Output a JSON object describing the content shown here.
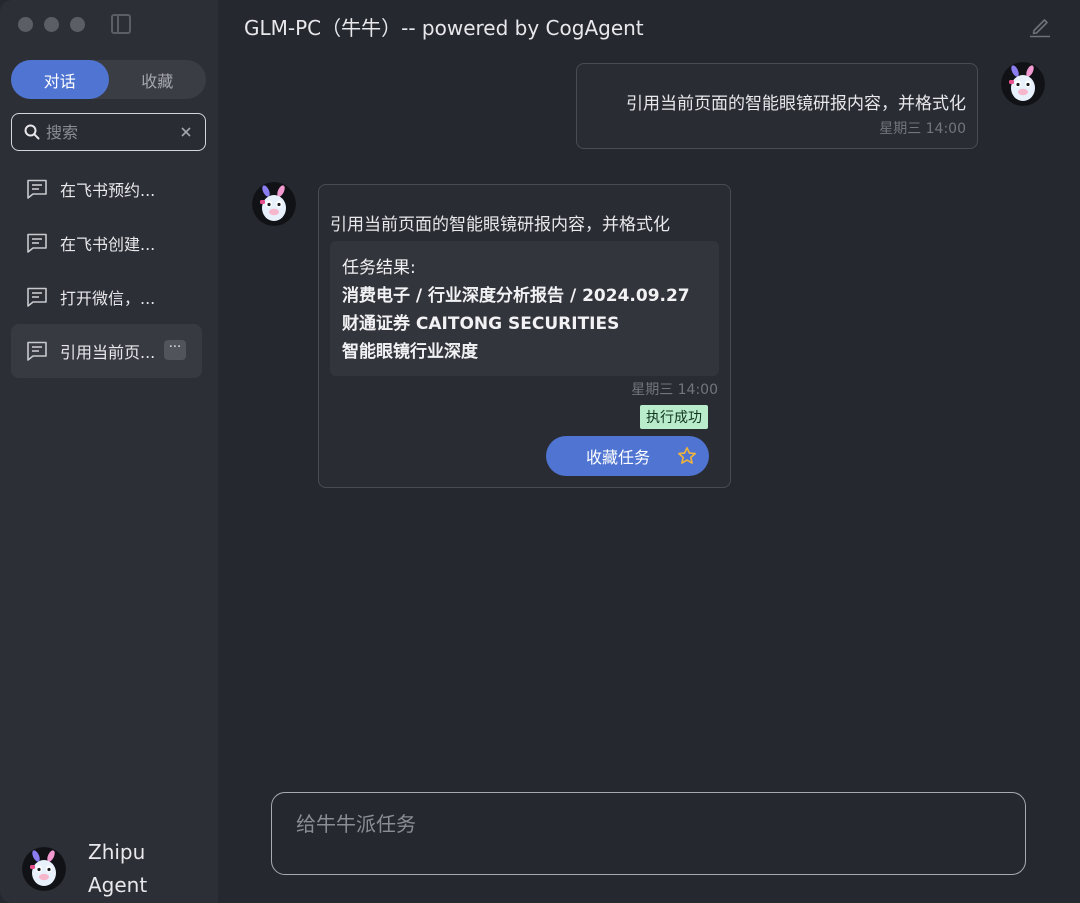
{
  "window": {
    "title": "GLM-PC（牛牛）-- powered by CogAgent"
  },
  "sidebar": {
    "tabs": [
      {
        "label": "对话",
        "active": true
      },
      {
        "label": "收藏",
        "active": false
      }
    ],
    "search": {
      "placeholder": "搜索",
      "value": ""
    },
    "conversations": [
      {
        "label": "在飞书预约..."
      },
      {
        "label": "在飞书创建..."
      },
      {
        "label": "打开微信，..."
      },
      {
        "label": "引用当前页...",
        "active": true
      }
    ],
    "more_label": "···",
    "user": {
      "name": "Zhipu Agent"
    }
  },
  "chat": {
    "user_message": {
      "text": "引用当前页面的智能眼镜研报内容，并格式化",
      "time": "星期三 14:00"
    },
    "bot_message": {
      "text": "引用当前页面的智能眼镜研报内容，并格式化",
      "result": [
        "任务结果:",
        "消费电子 / 行业深度分析报告 / 2024.09.27",
        "财通证券 CAITONG SECURITIES",
        "智能眼镜行业深度"
      ],
      "time": "星期三 14:00",
      "status": "执行成功",
      "favorite_label": "收藏任务"
    }
  },
  "composer": {
    "placeholder": "给牛牛派任务"
  },
  "colors": {
    "accent": "#4f74d2",
    "success_bg": "#b9eccb",
    "star": "#f0b43c"
  }
}
